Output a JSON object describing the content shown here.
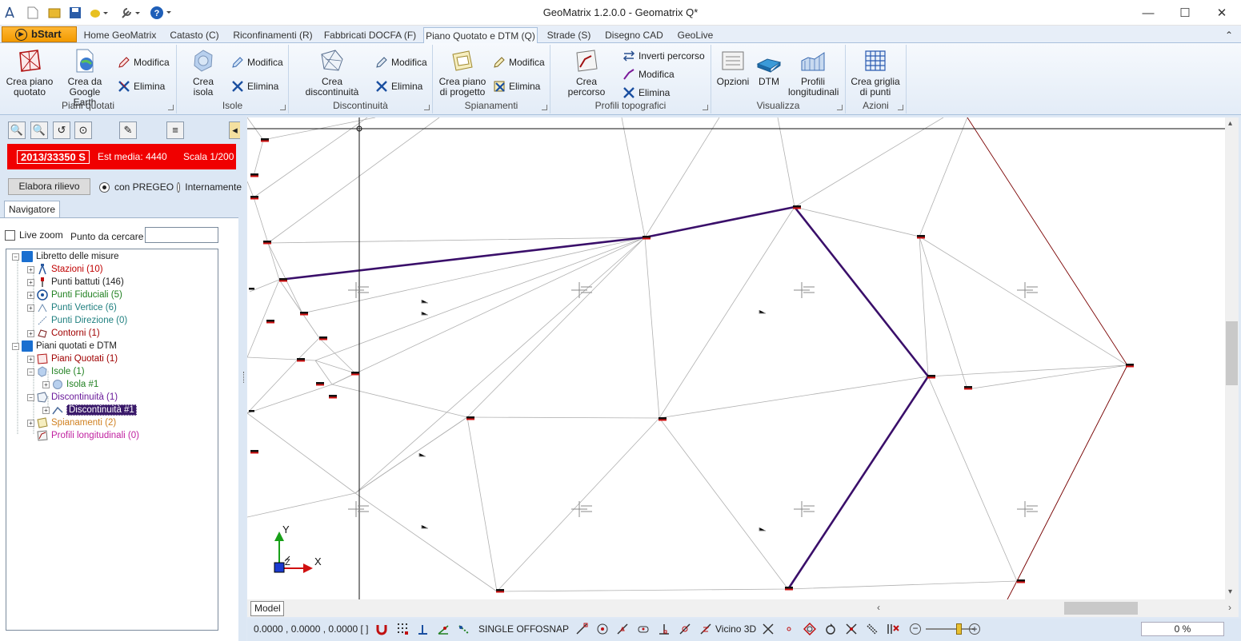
{
  "window": {
    "title": "GeoMatrix 1.2.0.0 - Geomatrix Q*",
    "minimize": "—",
    "maximize": "☐",
    "close": "✕"
  },
  "tabs": {
    "bstart": "bStart",
    "items": [
      "Home GeoMatrix",
      "Catasto (C)",
      "Riconfinamenti (R)",
      "Fabbricati DOCFA (F)",
      "Piano Quotato e DTM (Q)",
      "Strade (S)",
      "Disegno CAD",
      "GeoLive"
    ]
  },
  "ribbon": {
    "piani_quotati": {
      "label": "Piani quotati",
      "create": "Crea piano quotato",
      "create_l1": "Crea piano",
      "create_l2": "quotato",
      "google_l1": "Crea da",
      "google_l2": "Google Earth",
      "modify": "Modifica",
      "delete": "Elimina"
    },
    "isole": {
      "label": "Isole",
      "create": "Crea isola",
      "modify": "Modifica",
      "delete": "Elimina"
    },
    "discontinuita": {
      "label": "Discontinuità",
      "create": "Crea discontinuità",
      "modify": "Modifica",
      "delete": "Elimina"
    },
    "spianamenti": {
      "label": "Spianamenti",
      "create_l1": "Crea piano",
      "create_l2": "di progetto",
      "modify": "Modifica",
      "delete": "Elimina"
    },
    "profili": {
      "label": "Profili topografici",
      "create": "Crea percorso",
      "invert": "Inverti percorso",
      "modify": "Modifica",
      "delete": "Elimina"
    },
    "visualizza": {
      "label": "Visualizza",
      "options": "Opzioni",
      "dtm": "DTM",
      "profili_l1": "Profili",
      "profili_l2": "longitudinali"
    },
    "azioni": {
      "label": "Azioni",
      "grid_l1": "Crea griglia",
      "grid_l2": "di punti"
    }
  },
  "left": {
    "practice": "2013/33350 S",
    "est_media": "Est media: 4440",
    "scala": "Scala 1/200",
    "elabora": "Elabora rilievo",
    "radio1": "con PREGEO",
    "radio2": "Internamente",
    "nav_tab": "Navigatore",
    "live_zoom": "Live zoom",
    "search_label": "Punto da cercare",
    "search_value": ""
  },
  "tree": [
    {
      "label": "Libretto delle misure",
      "color": "#222222"
    },
    {
      "label": "Stazioni (10)",
      "color": "#c00000"
    },
    {
      "label": "Punti battuti (146)",
      "color": "#222222"
    },
    {
      "label": "Punti Fiduciali (5)",
      "color": "#208020"
    },
    {
      "label": "Punti Vertice (6)",
      "color": "#208080"
    },
    {
      "label": "Punti Direzione (0)",
      "color": "#208080"
    },
    {
      "label": "Contorni (1)",
      "color": "#a00000"
    },
    {
      "label": "Piani quotati e DTM",
      "color": "#222222"
    },
    {
      "label": "Piani Quotati (1)",
      "color": "#a00000"
    },
    {
      "label": "Isole (1)",
      "color": "#208020"
    },
    {
      "label": "Isola #1",
      "color": "#208020"
    },
    {
      "label": "Discontinuità (1)",
      "color": "#6a1a9a"
    },
    {
      "label": "Discontinuità #1",
      "color": "#ffffff"
    },
    {
      "label": "Spianamenti (2)",
      "color": "#d08020"
    },
    {
      "label": "Profili longitudinali (0)",
      "color": "#c020a0"
    }
  ],
  "canvas": {
    "axis_x": "X",
    "axis_y": "Y",
    "axis_z": "Z",
    "model_tab": "Model"
  },
  "status": {
    "coords": "0.0000 , 0.0000 , 0.0000 [  ]",
    "single": "SINGLE OFF",
    "osnap": "OSNAP",
    "vicino": "Vicino 3D",
    "zoom_pct": "0 %"
  },
  "colors": {
    "accent": "#a9c0dc",
    "red_bar": "#f00000",
    "discontinuity": "#4a1a7a",
    "selection": "#3a1a6a"
  }
}
